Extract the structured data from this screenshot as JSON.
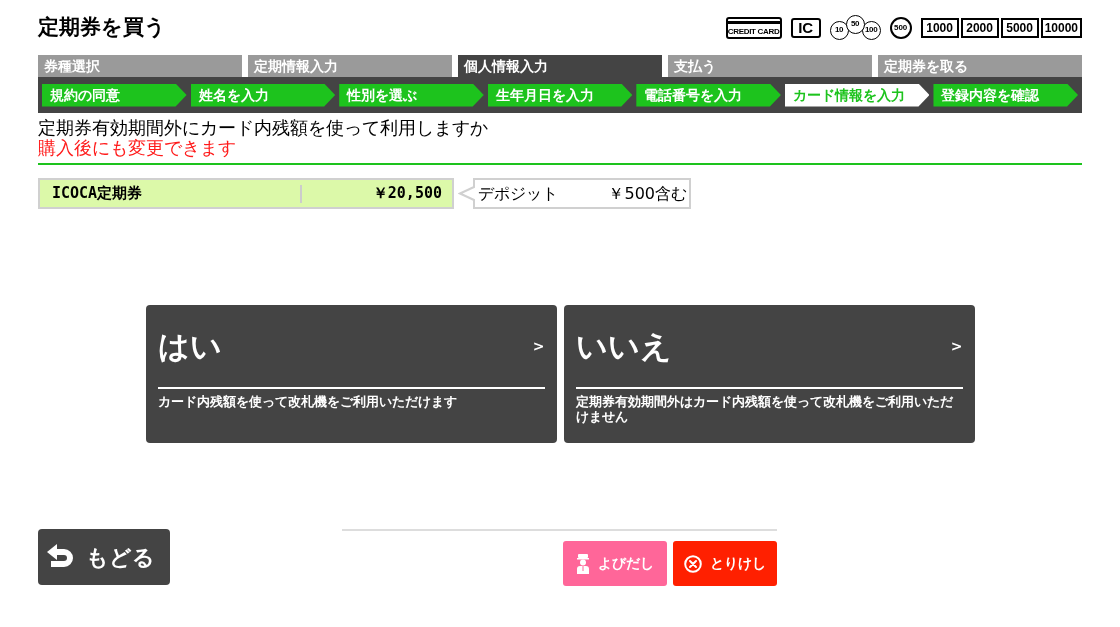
{
  "title": "定期券を買う",
  "payment_marks": [
    {
      "kind": "card",
      "label": "CREDIT CARD"
    },
    {
      "kind": "ic",
      "label": "IC"
    },
    {
      "kind": "coins",
      "labels": [
        "10",
        "50",
        "100"
      ]
    },
    {
      "kind": "coin",
      "label": "500"
    },
    {
      "kind": "note",
      "label": "1000"
    },
    {
      "kind": "note",
      "label": "2000"
    },
    {
      "kind": "note",
      "label": "5000"
    },
    {
      "kind": "note",
      "label": "10000"
    }
  ],
  "steps": [
    {
      "label": "券種選択",
      "selected": false
    },
    {
      "label": "定期情報入力",
      "selected": false
    },
    {
      "label": "個人情報入力",
      "selected": true
    },
    {
      "label": "支払う",
      "selected": false
    },
    {
      "label": "定期券を取る",
      "selected": false
    }
  ],
  "sub_steps": [
    {
      "label": "規約の同意",
      "selected": false
    },
    {
      "label": "姓名を入力",
      "selected": false
    },
    {
      "label": "性別を選ぶ",
      "selected": false
    },
    {
      "label": "生年月日を入力",
      "selected": false
    },
    {
      "label": "電話番号を入力",
      "selected": false
    },
    {
      "label": "カード情報を入力",
      "selected": true
    },
    {
      "label": "登録内容を確認",
      "selected": false
    }
  ],
  "question": "定期券有効期間外にカード内残額を使って利用しますか",
  "note": "購入後にも変更できます",
  "ticket": {
    "name": "ICOCA定期券",
    "price": "￥20,500"
  },
  "deposit": {
    "label": "デポジット",
    "amount": "￥500含む"
  },
  "choices": [
    {
      "label": "はい",
      "arrow": ">",
      "description": "カード内残額を使って改札機をご利用いただけます"
    },
    {
      "label": "いいえ",
      "arrow": ">",
      "description": "定期券有効期間外はカード内残額を使って改札機をご利用いただけません"
    }
  ],
  "back_button": {
    "label": "もどる"
  },
  "call_button": {
    "label": "よびだし"
  },
  "cancel_button": {
    "label": "とりけし"
  }
}
